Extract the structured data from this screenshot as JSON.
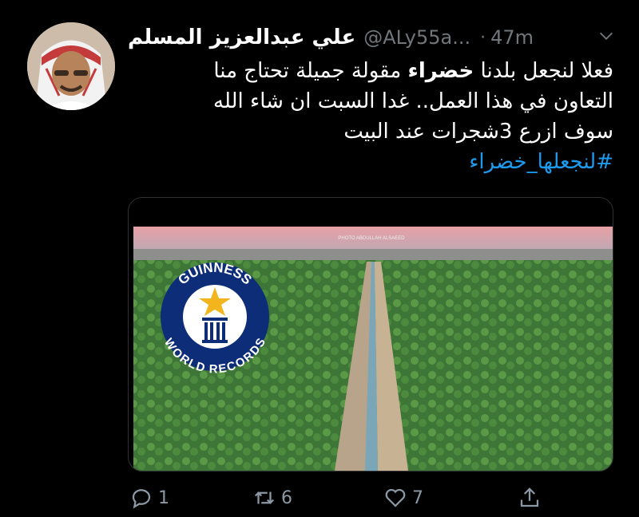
{
  "tweet": {
    "author_name": "علي عبدالعزيز المسلم",
    "handle": "@ALy55a...",
    "separator": "·",
    "time": "47m",
    "text_line1_a": "فعلا لنجعل بلدنا ",
    "text_line1_bold": "خضراء",
    "text_line1_b": " مقولة جميلة تحتاج منا",
    "text_line2": "التعاون في هذا العمل.. غدا السبت ان شاء الله",
    "text_line3": "سوف ازرع 3شجرات عند البيت",
    "hashtag": "#لنجعلها_خضراء"
  },
  "media": {
    "badge_top_text": "GUINNESS",
    "badge_bottom_text": "WORLD RECORDS",
    "watermark": "PHOTO ABDULLAH ALSAEED"
  },
  "actions": {
    "reply_count": "1",
    "retweet_count": "6",
    "like_count": "7"
  },
  "colors": {
    "background": "#000000",
    "link": "#1d9bf0",
    "muted": "#71767b"
  },
  "icons": [
    "chevron-down-icon",
    "reply-icon",
    "retweet-icon",
    "like-icon",
    "share-icon",
    "star-icon"
  ]
}
